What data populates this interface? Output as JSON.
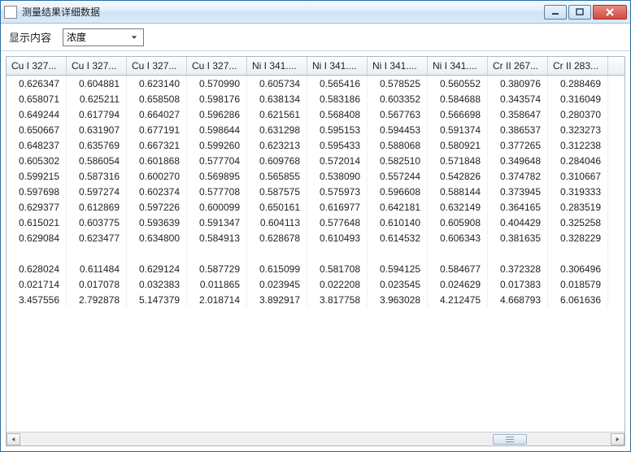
{
  "window": {
    "title": "测量结果详细数据"
  },
  "toolbar": {
    "label": "显示内容",
    "select_value": "浓度"
  },
  "table": {
    "headers": [
      "Cu I 327...",
      "Cu I 327...",
      "Cu I 327...",
      "Cu I 327...",
      "Ni I 341....",
      "Ni I 341....",
      "Ni I 341....",
      "Ni I 341....",
      "Cr II 267...",
      "Cr II 283..."
    ],
    "rows": [
      [
        "0.626347",
        "0.604881",
        "0.623140",
        "0.570990",
        "0.605734",
        "0.565416",
        "0.578525",
        "0.560552",
        "0.380976",
        "0.288469"
      ],
      [
        "0.658071",
        "0.625211",
        "0.658508",
        "0.598176",
        "0.638134",
        "0.583186",
        "0.603352",
        "0.584688",
        "0.343574",
        "0.316049"
      ],
      [
        "0.649244",
        "0.617794",
        "0.664027",
        "0.596286",
        "0.621561",
        "0.568408",
        "0.567763",
        "0.566698",
        "0.358647",
        "0.280370"
      ],
      [
        "0.650667",
        "0.631907",
        "0.677191",
        "0.598644",
        "0.631298",
        "0.595153",
        "0.594453",
        "0.591374",
        "0.386537",
        "0.323273"
      ],
      [
        "0.648237",
        "0.635769",
        "0.667321",
        "0.599260",
        "0.623213",
        "0.595433",
        "0.588068",
        "0.580921",
        "0.377265",
        "0.312238"
      ],
      [
        "0.605302",
        "0.586054",
        "0.601868",
        "0.577704",
        "0.609768",
        "0.572014",
        "0.582510",
        "0.571848",
        "0.349648",
        "0.284046"
      ],
      [
        "0.599215",
        "0.587316",
        "0.600270",
        "0.569895",
        "0.565855",
        "0.538090",
        "0.557244",
        "0.542826",
        "0.374782",
        "0.310667"
      ],
      [
        "0.597698",
        "0.597274",
        "0.602374",
        "0.577708",
        "0.587575",
        "0.575973",
        "0.596608",
        "0.588144",
        "0.373945",
        "0.319333"
      ],
      [
        "0.629377",
        "0.612869",
        "0.597226",
        "0.600099",
        "0.650161",
        "0.616977",
        "0.642181",
        "0.632149",
        "0.364165",
        "0.283519"
      ],
      [
        "0.615021",
        "0.603775",
        "0.593639",
        "0.591347",
        "0.604113",
        "0.577648",
        "0.610140",
        "0.605908",
        "0.404429",
        "0.325258"
      ],
      [
        "0.629084",
        "0.623477",
        "0.634800",
        "0.584913",
        "0.628678",
        "0.610493",
        "0.614532",
        "0.606343",
        "0.381635",
        "0.328229"
      ],
      [
        "",
        "",
        "",
        "",
        "",
        "",
        "",
        "",
        "",
        ""
      ],
      [
        "0.628024",
        "0.611484",
        "0.629124",
        "0.587729",
        "0.615099",
        "0.581708",
        "0.594125",
        "0.584677",
        "0.372328",
        "0.306496"
      ],
      [
        "0.021714",
        "0.017078",
        "0.032383",
        "0.011865",
        "0.023945",
        "0.022208",
        "0.023545",
        "0.024629",
        "0.017383",
        "0.018579"
      ],
      [
        "3.457556",
        "2.792878",
        "5.147379",
        "2.018714",
        "3.892917",
        "3.817758",
        "3.963028",
        "4.212475",
        "4.668793",
        "6.061636"
      ]
    ]
  }
}
